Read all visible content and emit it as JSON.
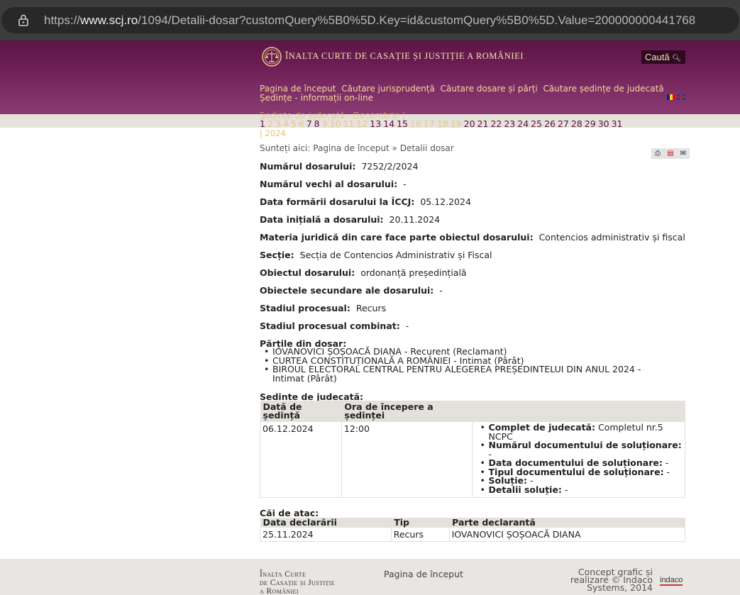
{
  "browser": {
    "url_prefix": "https://",
    "url_domain": "www.scj.ro",
    "url_path": "/1094/Detalii-dosar?customQuery%5B0%5D.Key=id&customQuery%5B0%5D.Value=200000000441768"
  },
  "header": {
    "site_title": "Înalta Curte de Casație și Justiție a României",
    "search_label": "Caută",
    "nav": [
      "Pagina de început",
      "Căutare jurisprudență",
      "Căutare dosare și părți",
      "Căutare ședințe de judecată",
      "Ședințe - informații on-line"
    ],
    "submenu": "Ședințe de judecată · Decembrie |",
    "days": [
      "1",
      "2",
      "3",
      "4",
      "5",
      "6",
      "7",
      "8",
      "9",
      "10",
      "11",
      "12",
      "13",
      "14",
      "15",
      "16",
      "17",
      "18",
      "19",
      "20",
      "21",
      "22",
      "23",
      "24",
      "25",
      "26",
      "27",
      "28",
      "29",
      "30",
      "31"
    ],
    "year": "| 2024"
  },
  "breadcrumb": {
    "prefix": "Sunteți aici:",
    "home": "Pagina de început",
    "separator": "»",
    "current": "Detalii dosar"
  },
  "fields": [
    {
      "label": "Numărul dosarului:",
      "value": "7252/2/2024"
    },
    {
      "label": "Numărul vechi al dosarului:",
      "value": "-"
    },
    {
      "label": "Data formării dosarului la ÎCCJ:",
      "value": "05.12.2024"
    },
    {
      "label": "Data inițială a dosarului:",
      "value": "20.11.2024"
    },
    {
      "label": "Materia juridică din care face parte obiectul dosarului:",
      "value": "Contencios administrativ și fiscal"
    },
    {
      "label": "Secție:",
      "value": "Secția de Contencios Administrativ și Fiscal"
    },
    {
      "label": "Obiectul dosarului:",
      "value": "ordonanță președințială"
    },
    {
      "label": "Obiectele secundare ale dosarului:",
      "value": "-"
    },
    {
      "label": "Stadiul procesual:",
      "value": "Recurs"
    },
    {
      "label": "Stadiul procesual combinat:",
      "value": "-"
    }
  ],
  "parties": {
    "title": "Părțile din dosar:",
    "items": [
      "IOVANOVICI ȘOȘOACĂ DIANA - Recurent (Reclamant)",
      "CURTEA CONSTITUȚIONALĂ A ROMÂNIEI - Intimat (Pârât)",
      "BIROUL ELECTORAL CENTRAL PENTRU ALEGEREA PREȘEDINTELUI DIN ANUL 2024 - Intimat (Pârât)"
    ]
  },
  "hearings": {
    "title": "Ședințe de judecată:",
    "headers": [
      "Dată de ședință",
      "Ora de începere a ședinței"
    ],
    "rows": [
      {
        "date": "06.12.2024",
        "time": "12:00",
        "details": [
          {
            "label": "Complet de judecată:",
            "value": "Completul nr.5 NCPC"
          },
          {
            "label": "Numărul documentului de soluționare:",
            "value": "-"
          },
          {
            "label": "Data documentului de soluționare:",
            "value": "-"
          },
          {
            "label": "Tipul documentului de soluționare:",
            "value": "-"
          },
          {
            "label": "Soluție:",
            "value": "-"
          },
          {
            "label": "Detalii soluție:",
            "value": "-"
          }
        ]
      }
    ]
  },
  "appeals": {
    "title": "Căi de atac:",
    "headers": [
      "Data declarării",
      "Tip",
      "Parte declarantă"
    ],
    "rows": [
      {
        "date": "25.11.2024",
        "type": "Recurs",
        "party": "IOVANOVICI ȘOȘOACĂ DIANA"
      }
    ]
  },
  "footer": {
    "name_line1": "Înalta Curte",
    "name_line2": "de Casație și Justiție",
    "name_line3": "a României",
    "home_link": "Pagina de început",
    "credit": "Concept grafic și realizare © Indaco Systems, 2014",
    "logo_text": "indaco"
  }
}
